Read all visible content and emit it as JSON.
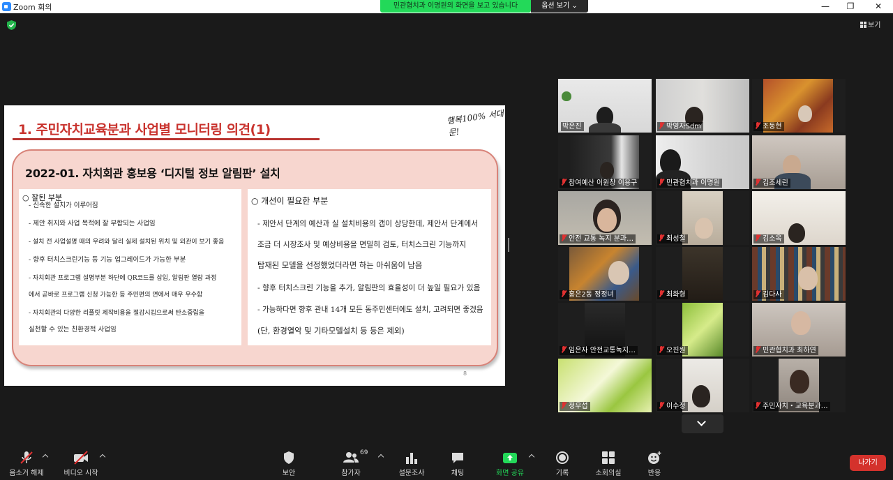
{
  "window": {
    "title": "Zoom 회의",
    "share_banner": "민관협치과 이명원의 화면을 보고 있습니다",
    "view_options": "옵션 보기 ⌄",
    "minimize": "—",
    "maximize": "❐",
    "close": "✕"
  },
  "view_button": "보기",
  "slide": {
    "title": "1. 주민자치교육분과 사업별 모니터링 의견(1)",
    "logo_text": "행복100% 서대문!",
    "subtitle": "2022-01. 자치회관 홍보용  ‘디지털 정보 알림판’  설치",
    "good": {
      "heading": "○ 잘된 부분",
      "items": [
        "- 신속한 설치가 이루어짐",
        "- 제안 취지와 사업 목적에 잘 부합되는 사업임",
        "- 설치 전 사업설명 때의 우려와 달리 실제 설치된 위치 및 외관이 보기 좋음",
        "- 향후 터치스크린기능 등 기능 업그레이드가 가능한 부분",
        "- 자치회관 프로그램 설명부분 하단에 QR코드를 삽입, 알림판 열람 과정",
        "  에서 곧바로 프로그램 신청 가능한 등 주민편의 면에서 매우 우수함",
        "- 자치회관의 다양한 리플릿 제작비용을 절감시킴으로써 탄소중립을",
        "  실천할 수 있는 친환경적 사업임"
      ]
    },
    "improve": {
      "heading": "○ 개선이 필요한 부분",
      "items": [
        "- 제안서 단계의 예산과 실 설치비용의 갭이 상당한데, 제안서 단계에서",
        "  조금 더 시장조사 및 예상비용을 면밀히 검토, 터치스크린 기능까지",
        "  탑재된 모델을 선정했었더라면 하는 아쉬움이 남음",
        "- 향후 터치스크린 기능을 추가, 알림판의 효율성이 더 높일 필요가 있음",
        "- 가능하다면 향후 관내 14개 모든 동주민센터에도 설치, 고려되면 좋겠음",
        "  (단, 환경열악 및 기타모델설치 등 등은 제외)"
      ]
    },
    "page_number": "8"
  },
  "participants": [
    {
      "name": "박은진",
      "muted": false,
      "active": true
    },
    {
      "name": "박영자Sdm",
      "muted": true
    },
    {
      "name": "조동현",
      "muted": true
    },
    {
      "name": "참여예산 이원창 이용구",
      "muted": true
    },
    {
      "name": "민관협치과 이명원",
      "muted": true
    },
    {
      "name": "김조세린",
      "muted": true
    },
    {
      "name": "안전 교통 녹지 분과…",
      "muted": true
    },
    {
      "name": "최성철",
      "muted": true
    },
    {
      "name": "김소옥",
      "muted": true
    },
    {
      "name": "홍은2동 정정녀",
      "muted": true
    },
    {
      "name": "최화형",
      "muted": true
    },
    {
      "name": "김다사",
      "muted": true
    },
    {
      "name": "임은자 안전교통녹지…",
      "muted": true
    },
    {
      "name": "오진원",
      "muted": true
    },
    {
      "name": "민관협치과 최하연",
      "muted": true
    },
    {
      "name": "정우섭",
      "muted": true
    },
    {
      "name": "이수정",
      "muted": true
    },
    {
      "name": "주민자치・교육분과…",
      "muted": true
    }
  ],
  "toolbar": {
    "unmute": "음소거 해제",
    "start_video": "비디오 시작",
    "security": "보안",
    "participants": "참가자",
    "participants_count": "69",
    "polls": "설문조사",
    "chat": "채팅",
    "share_screen": "화면 공유",
    "record": "기록",
    "breakout": "소회의실",
    "reactions": "반응",
    "leave": "나가기"
  },
  "colors": {
    "share_green": "#23d959",
    "leave_red": "#d4322c",
    "active_speaker": "#dff05a",
    "muted_red": "#e03131"
  }
}
